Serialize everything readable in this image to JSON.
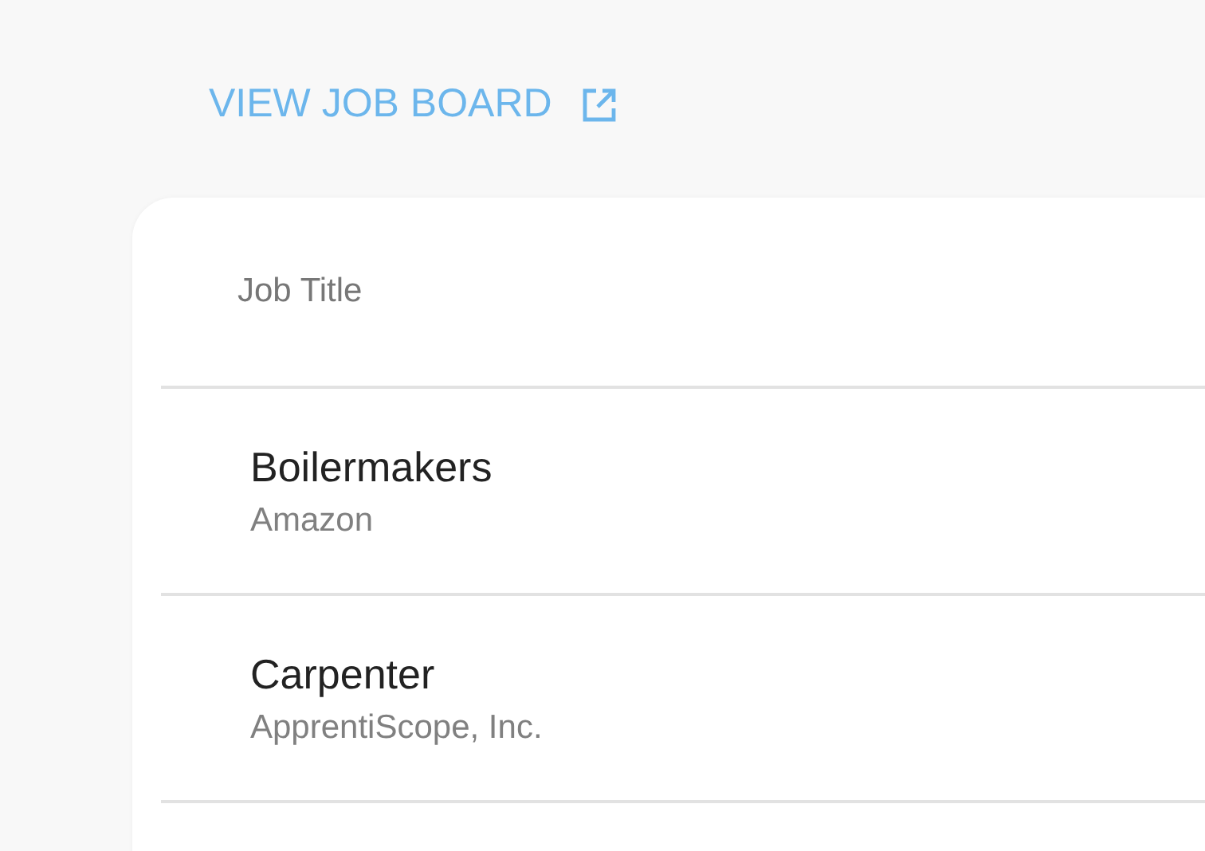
{
  "job_board_link": {
    "label": "VIEW JOB BOARD"
  },
  "table": {
    "columns": [
      "Job Title"
    ],
    "rows": [
      {
        "title": "Boilermakers",
        "company": "Amazon"
      },
      {
        "title": "Carpenter",
        "company": "ApprentiScope, Inc."
      }
    ]
  }
}
